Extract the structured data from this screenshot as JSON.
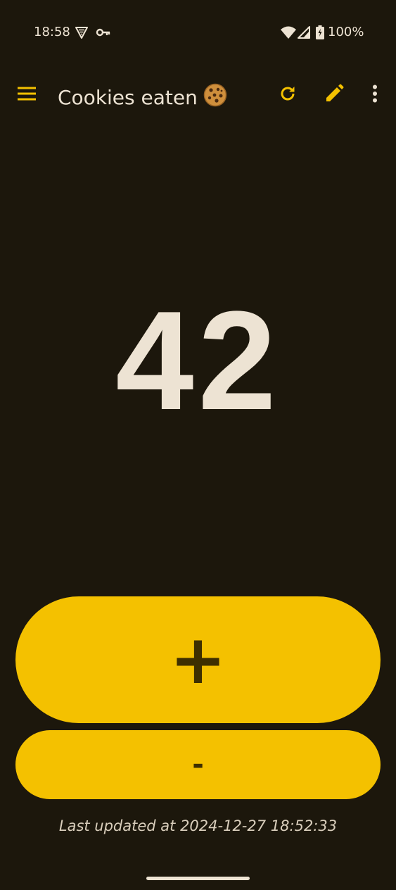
{
  "status_bar": {
    "time": "18:58",
    "battery_percent": "100%",
    "icons": [
      "vpn-shield-icon",
      "key-icon",
      "wifi-icon",
      "cell-signal-icon",
      "battery-charging-icon"
    ]
  },
  "toolbar": {
    "title": "Cookies eaten",
    "title_emoji": "cookie-icon",
    "icons": [
      "menu-icon",
      "refresh-icon",
      "edit-icon",
      "more-vert-icon"
    ]
  },
  "counter": {
    "value": "42"
  },
  "actions": {
    "increment_label": "+",
    "decrement_label": "-"
  },
  "footer": {
    "last_updated": "Last updated at 2024-12-27 18:52:33"
  },
  "colors": {
    "background": "#1c170c",
    "accent": "#f4c100",
    "on_accent": "#3e2f00",
    "text": "#ede3d3"
  }
}
